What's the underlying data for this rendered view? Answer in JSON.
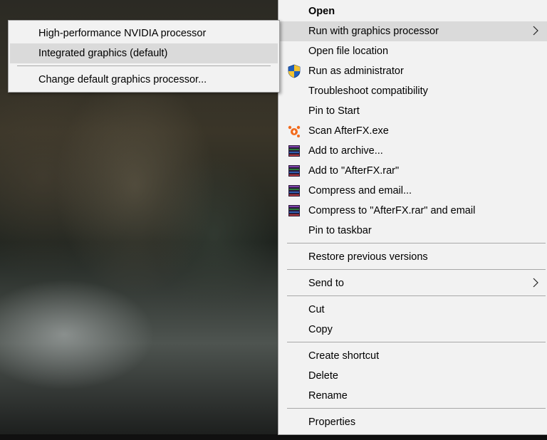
{
  "main_menu": {
    "items": [
      {
        "label": "Open",
        "bold": true
      },
      {
        "label": "Run with graphics processor",
        "submenu": true,
        "highlighted": true
      },
      {
        "label": "Open file location"
      },
      {
        "label": "Run as administrator",
        "icon": "uac-shield-icon"
      },
      {
        "label": "Troubleshoot compatibility"
      },
      {
        "label": "Pin to Start"
      },
      {
        "label": "Scan AfterFX.exe",
        "icon": "avast-icon"
      },
      {
        "label": "Add to archive...",
        "icon": "winrar-icon"
      },
      {
        "label": "Add to \"AfterFX.rar\"",
        "icon": "winrar-icon"
      },
      {
        "label": "Compress and email...",
        "icon": "winrar-icon"
      },
      {
        "label": "Compress to \"AfterFX.rar\" and email",
        "icon": "winrar-icon"
      },
      {
        "label": "Pin to taskbar"
      },
      {
        "label": "Restore previous versions"
      },
      {
        "label": "Send to",
        "submenu": true
      },
      {
        "label": "Cut"
      },
      {
        "label": "Copy"
      },
      {
        "label": "Create shortcut"
      },
      {
        "label": "Delete"
      },
      {
        "label": "Rename"
      },
      {
        "label": "Properties"
      }
    ],
    "submenu_arrow": ">"
  },
  "sub_menu": {
    "items": [
      {
        "label": "High-performance NVIDIA processor"
      },
      {
        "label": "Integrated graphics (default)",
        "highlighted": true
      },
      {
        "label": "Change default graphics processor..."
      }
    ]
  },
  "colors": {
    "menu_bg": "#f2f2f2",
    "highlight": "#dadada",
    "separator": "#a8a8a8",
    "shield_blue": "#1f5fbf",
    "shield_yellow": "#f2c230",
    "avast_orange": "#f26b1d"
  }
}
